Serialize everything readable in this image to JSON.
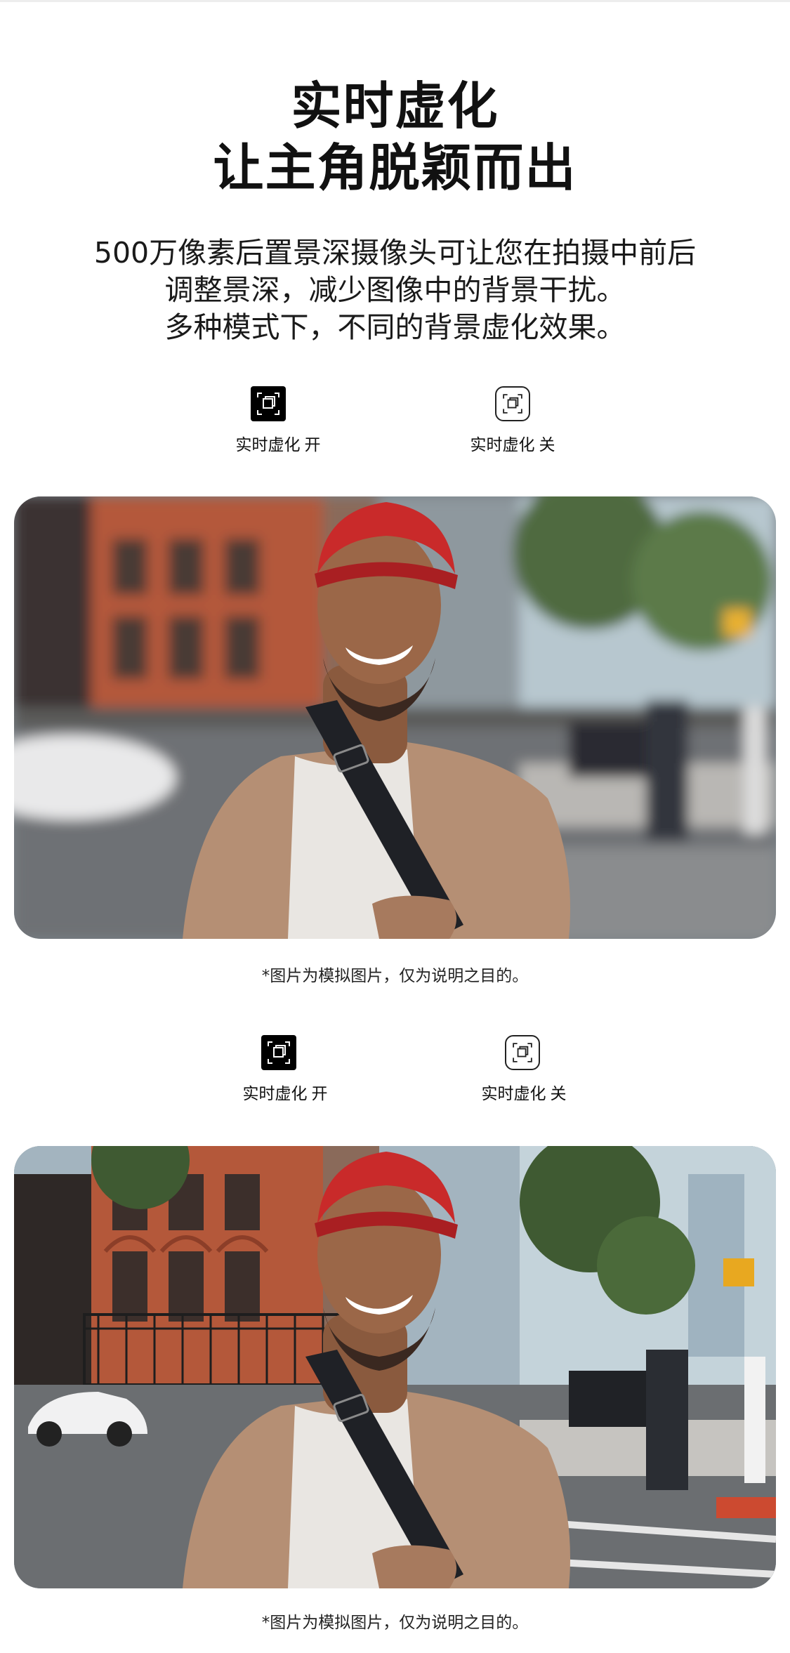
{
  "heading": {
    "line1": "实时虚化",
    "line2": "让主角脱颖而出"
  },
  "description": {
    "line1": "500万像素后置景深摄像头可让您在拍摄中前后",
    "line2": "调整景深，减少图像中的背景干扰。",
    "line3": "多种模式下，不同的背景虚化效果。"
  },
  "sections": [
    {
      "toggle_on": {
        "label": "实时虚化",
        "state": "开",
        "icon": "live-focus-icon",
        "selected": true
      },
      "toggle_off": {
        "label": "实时虚化",
        "state": "关",
        "icon": "live-focus-icon",
        "selected": false
      },
      "photo": {
        "background": "blurred",
        "subject": "man in red beanie and tan cardigan on city street"
      },
      "caption": "*图片为模拟图片，仅为说明之目的。"
    },
    {
      "toggle_on": {
        "label": "实时虚化",
        "state": "开",
        "icon": "live-focus-icon",
        "selected": false
      },
      "toggle_off": {
        "label": "实时虚化",
        "state": "关",
        "icon": "live-focus-icon",
        "selected": true
      },
      "photo": {
        "background": "sharp",
        "subject": "man in red beanie and tan cardigan on city street"
      },
      "caption": "*图片为模拟图片，仅为说明之目的。"
    }
  ],
  "colors": {
    "text": "#111111",
    "icon_active_bg": "#000000",
    "beanie": "#c92a2a",
    "cardigan": "#b58f74",
    "brick": "#b4583a"
  }
}
